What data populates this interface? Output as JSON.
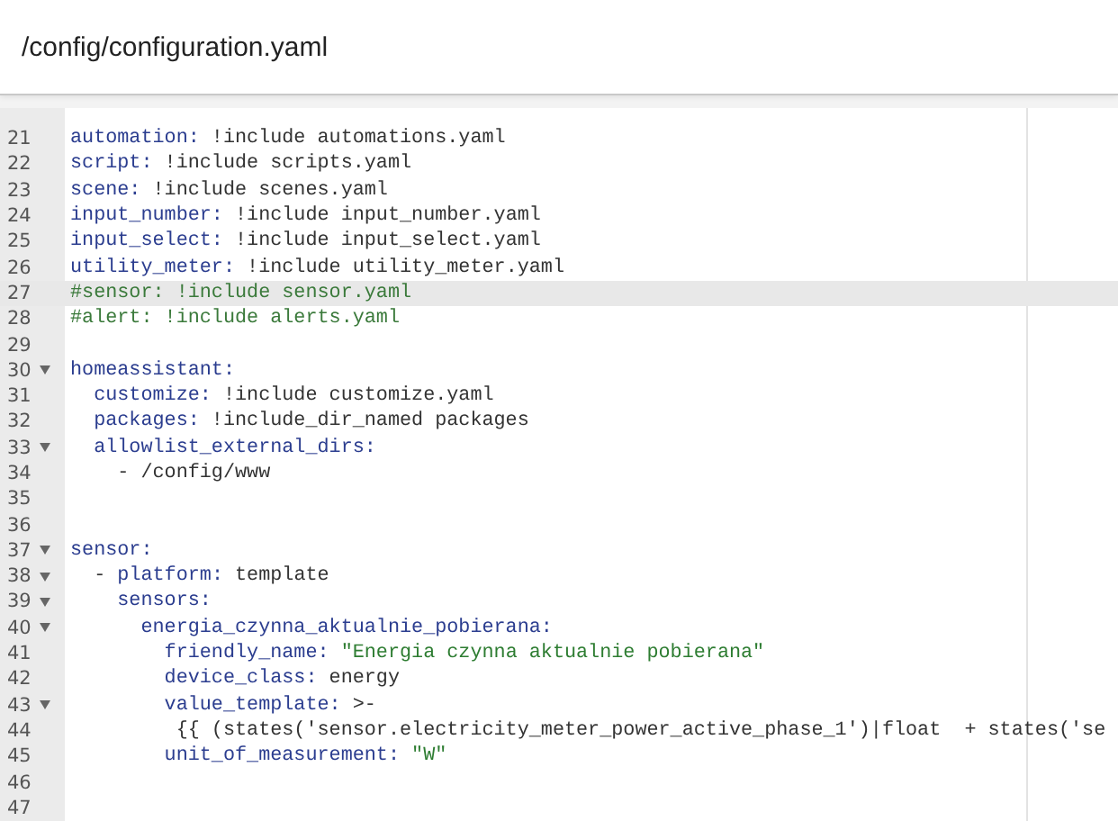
{
  "header": {
    "title": "/config/configuration.yaml"
  },
  "editor": {
    "lines": [
      {
        "number": "21",
        "fold": false,
        "active": false,
        "tokens": [
          {
            "kind": "key",
            "text": "automation:"
          },
          {
            "kind": "plain",
            "text": " !include automations.yaml"
          }
        ]
      },
      {
        "number": "22",
        "fold": false,
        "active": false,
        "tokens": [
          {
            "kind": "key",
            "text": "script:"
          },
          {
            "kind": "plain",
            "text": " !include scripts.yaml"
          }
        ]
      },
      {
        "number": "23",
        "fold": false,
        "active": false,
        "tokens": [
          {
            "kind": "key",
            "text": "scene:"
          },
          {
            "kind": "plain",
            "text": " !include scenes.yaml"
          }
        ]
      },
      {
        "number": "24",
        "fold": false,
        "active": false,
        "tokens": [
          {
            "kind": "key",
            "text": "input_number:"
          },
          {
            "kind": "plain",
            "text": " !include input_number.yaml"
          }
        ]
      },
      {
        "number": "25",
        "fold": false,
        "active": false,
        "tokens": [
          {
            "kind": "key",
            "text": "input_select:"
          },
          {
            "kind": "plain",
            "text": " !include input_select.yaml"
          }
        ]
      },
      {
        "number": "26",
        "fold": false,
        "active": false,
        "tokens": [
          {
            "kind": "key",
            "text": "utility_meter:"
          },
          {
            "kind": "plain",
            "text": " !include utility_meter.yaml"
          }
        ]
      },
      {
        "number": "27",
        "fold": false,
        "active": true,
        "tokens": [
          {
            "kind": "comment",
            "text": "#sensor: !include sensor.yaml"
          }
        ]
      },
      {
        "number": "28",
        "fold": false,
        "active": false,
        "tokens": [
          {
            "kind": "comment",
            "text": "#alert: !include alerts.yaml"
          }
        ]
      },
      {
        "number": "29",
        "fold": false,
        "active": false
      },
      {
        "number": "30",
        "fold": true,
        "active": false,
        "tokens": [
          {
            "kind": "key",
            "text": "homeassistant:"
          }
        ]
      },
      {
        "number": "31",
        "fold": false,
        "active": false,
        "tokens": [
          {
            "kind": "key",
            "text": "  customize:"
          },
          {
            "kind": "plain",
            "text": " !include customize.yaml"
          }
        ]
      },
      {
        "number": "32",
        "fold": false,
        "active": false,
        "tokens": [
          {
            "kind": "key",
            "text": "  packages:"
          },
          {
            "kind": "plain",
            "text": " !include_dir_named packages"
          }
        ]
      },
      {
        "number": "33",
        "fold": true,
        "active": false,
        "tokens": [
          {
            "kind": "key",
            "text": "  allowlist_external_dirs:"
          }
        ]
      },
      {
        "number": "34",
        "fold": false,
        "active": false,
        "tokens": [
          {
            "kind": "plain",
            "text": "    - /config/www"
          }
        ]
      },
      {
        "number": "35",
        "fold": false,
        "active": false
      },
      {
        "number": "36",
        "fold": false,
        "active": false
      },
      {
        "number": "37",
        "fold": true,
        "active": false,
        "tokens": [
          {
            "kind": "key",
            "text": "sensor:"
          }
        ]
      },
      {
        "number": "38",
        "fold": true,
        "active": false,
        "tokens": [
          {
            "kind": "plain",
            "text": "  - "
          },
          {
            "kind": "key",
            "text": "platform:"
          },
          {
            "kind": "plain",
            "text": " template"
          }
        ]
      },
      {
        "number": "39",
        "fold": true,
        "active": false,
        "tokens": [
          {
            "kind": "key",
            "text": "    sensors:"
          }
        ]
      },
      {
        "number": "40",
        "fold": true,
        "active": false,
        "tokens": [
          {
            "kind": "key",
            "text": "      energia_czynna_aktualnie_pobierana:"
          }
        ]
      },
      {
        "number": "41",
        "fold": false,
        "active": false,
        "tokens": [
          {
            "kind": "key",
            "text": "        friendly_name:"
          },
          {
            "kind": "string",
            "text": " \"Energia czynna aktualnie pobierana\""
          }
        ]
      },
      {
        "number": "42",
        "fold": false,
        "active": false,
        "tokens": [
          {
            "kind": "key",
            "text": "        device_class:"
          },
          {
            "kind": "plain",
            "text": " energy"
          }
        ]
      },
      {
        "number": "43",
        "fold": true,
        "active": false,
        "tokens": [
          {
            "kind": "key",
            "text": "        value_template:"
          },
          {
            "kind": "plain",
            "text": " >-"
          }
        ]
      },
      {
        "number": "44",
        "fold": false,
        "active": false,
        "tokens": [
          {
            "kind": "plain",
            "text": "         {{ (states('sensor.electricity_meter_power_active_phase_1')|float  + states('se"
          }
        ]
      },
      {
        "number": "45",
        "fold": false,
        "active": false,
        "tokens": [
          {
            "kind": "key",
            "text": "        unit_of_measurement:"
          },
          {
            "kind": "string",
            "text": " \"W\""
          }
        ]
      },
      {
        "number": "46",
        "fold": false,
        "active": false
      },
      {
        "number": "47",
        "fold": false,
        "active": false
      }
    ]
  }
}
